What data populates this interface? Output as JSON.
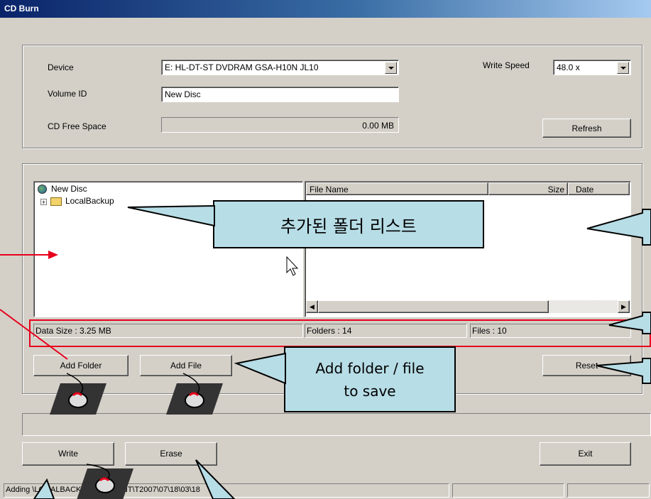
{
  "window": {
    "title": "CD Burn"
  },
  "settings": {
    "device_label": "Device",
    "device_value": "E: HL-DT-ST DVDRAM GSA-H10N JL10",
    "volume_label": "Volume ID",
    "volume_value": "New Disc",
    "free_space_label": "CD Free Space",
    "free_space_value": "0.00 MB",
    "write_speed_label": "Write Speed",
    "write_speed_value": "48.0 x",
    "refresh_label": "Refresh"
  },
  "tree": {
    "root": "New Disc",
    "child": "LocalBackup"
  },
  "file_list": {
    "columns": [
      "File Name",
      "Size",
      "Date"
    ]
  },
  "summary": {
    "data_size": "Data Size : 3.25 MB",
    "folders": "Folders : 14",
    "files": "Files : 10"
  },
  "buttons": {
    "add_folder": "Add Folder",
    "add_file": "Add File",
    "reset": "Reset",
    "write": "Write",
    "erase": "Erase",
    "exit": "Exit"
  },
  "status": {
    "text": "Adding \\LOCALBACKUP\\CURRENT\\T2007\\07\\18\\03\\18"
  },
  "callouts": {
    "folder_list": "추가된 폴더 리스트",
    "add_to_save": "Add folder / file\nto save"
  },
  "colors": {
    "window_bg": "#d4d0c8",
    "callout_bg": "#b7dde6",
    "highlight_red": "#e8001c"
  }
}
